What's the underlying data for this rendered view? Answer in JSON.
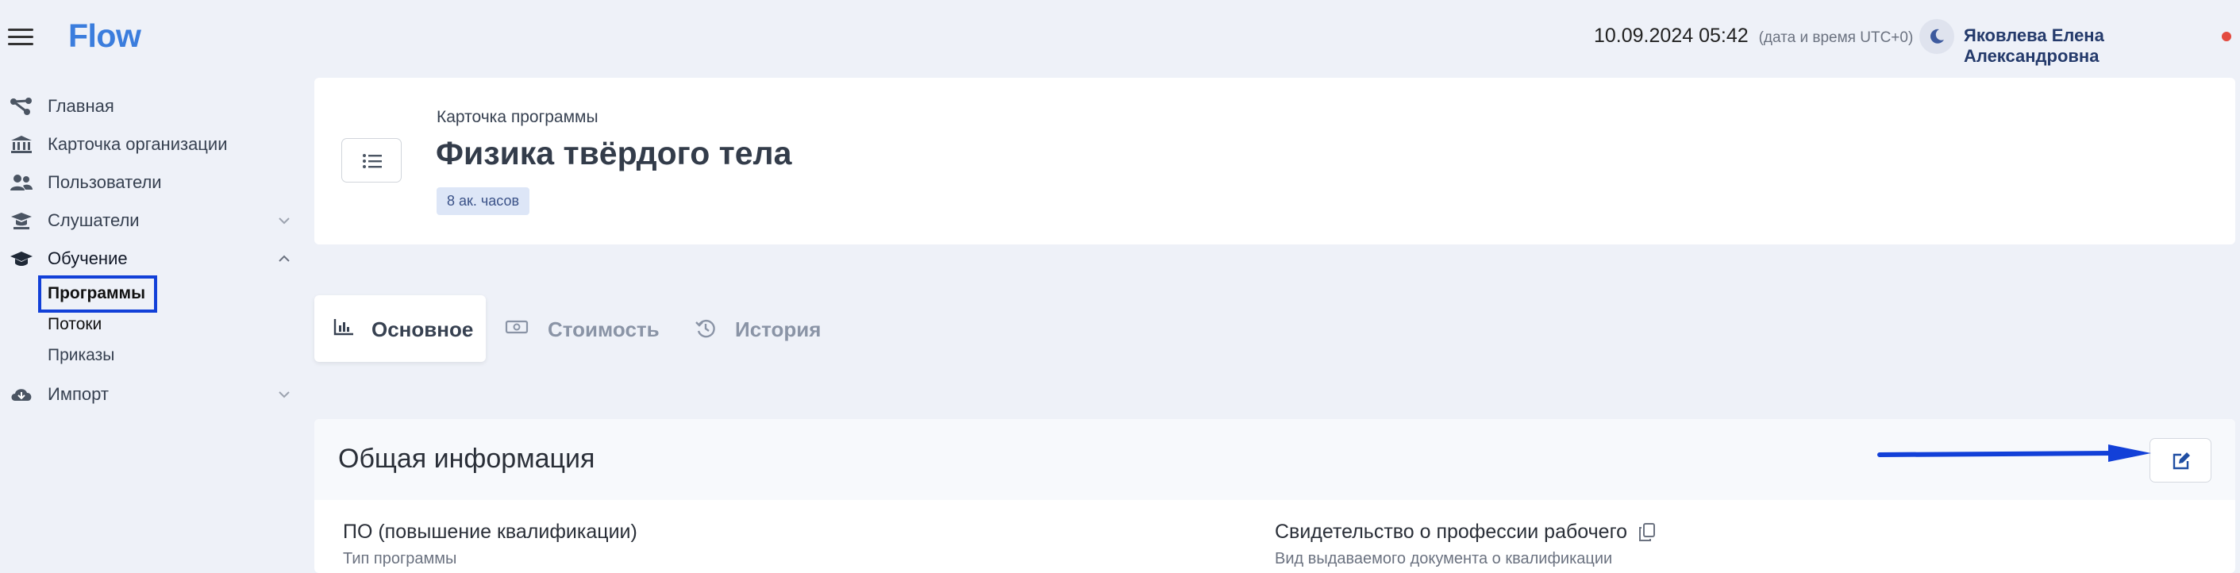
{
  "header": {
    "app_name": "Flow",
    "datetime": "10.09.2024 05:42",
    "datetime_note": "(дата и время UTC+0)",
    "user_name": "Яковлева Елена Александровна",
    "menu_icon": "hamburger-icon",
    "theme_icon": "moon-icon"
  },
  "sidebar": {
    "items": [
      {
        "label": "Главная",
        "icon": "flow-icon"
      },
      {
        "label": "Карточка организации",
        "icon": "bank-icon"
      },
      {
        "label": "Пользователи",
        "icon": "users-icon"
      },
      {
        "label": "Слушатели",
        "icon": "student-icon"
      },
      {
        "label": "Обучение",
        "icon": "graduation-cap-icon"
      },
      {
        "label": "Импорт",
        "icon": "cloud-download-icon"
      }
    ],
    "training_children": [
      "Программы",
      "Потоки",
      "Приказы"
    ]
  },
  "program": {
    "subtitle": "Карточка программы",
    "title": "Физика твёрдого тела",
    "hours_badge": "8 ак. часов"
  },
  "tabs": [
    {
      "label": "Основное",
      "icon": "chart-icon",
      "active": true
    },
    {
      "label": "Стоимость",
      "icon": "money-icon",
      "active": false
    },
    {
      "label": "История",
      "icon": "history-icon",
      "active": false
    }
  ],
  "general_info": {
    "title": "Общая информация",
    "program_type_value": "ПО (повышение квалификации)",
    "program_type_caption": "Тип программы",
    "document_value": "Свидетельство о профессии рабочего",
    "document_caption": "Вид выдаваемого документа о квалификации"
  },
  "colors": {
    "accent": "#3b7ddd",
    "background": "#eef1f8",
    "highlight_box": "#1240d8",
    "status_dot": "#e34a3f"
  }
}
